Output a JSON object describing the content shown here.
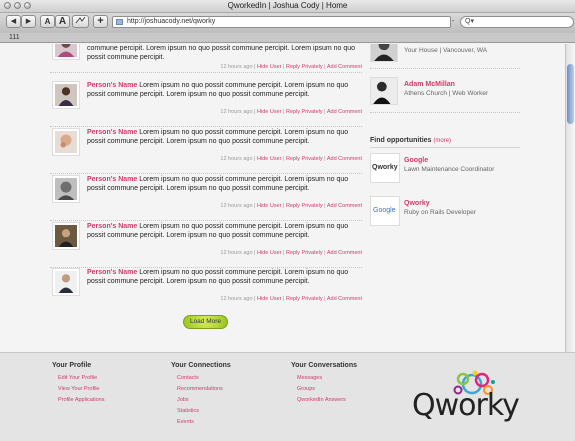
{
  "window": {
    "title": "QworkedIn | Joshua Cody | Home"
  },
  "toolbar": {
    "back_label": "◀",
    "forward_label": "▶",
    "text_smaller_label": "A",
    "text_larger_label": "A",
    "add_bookmark_label": "+",
    "address": "http://joshuacody.net/qworky",
    "search_placeholder": "Q▾"
  },
  "bookmarks_bar": {
    "label": "111"
  },
  "top_post": {
    "text": "commune percipit. Lorem ipsum no quo possit commune percipit. Lorem ipsum no quo possit commune percipit.",
    "time": "12 hours ago",
    "hide": "Hide User",
    "reply": "Reply Privately",
    "comment": "Add Comment"
  },
  "posts": [
    {
      "name": "Person's Name",
      "line1": "Lorem ipsum no quo possit commune percipit. Lorem ipsum no quo",
      "line2": "possit commune percipit. Lorem ipsum no quo possit commune percipit.",
      "time": "12 hours ago",
      "hide": "Hide User",
      "reply": "Reply Privately",
      "comment": "Add Comment"
    },
    {
      "name": "Person's Name",
      "line1": "Lorem ipsum no quo possit commune percipit. Lorem ipsum no quo",
      "line2": "possit commune percipit. Lorem ipsum no quo possit commune percipit.",
      "time": "12 hours ago",
      "hide": "Hide User",
      "reply": "Reply Privately",
      "comment": "Add Comment"
    },
    {
      "name": "Person's Name",
      "line1": "Lorem ipsum no quo possit commune percipit. Lorem ipsum no quo",
      "line2": "possit commune percipit. Lorem ipsum no quo possit commune percipit.",
      "time": "12 hours ago",
      "hide": "Hide User",
      "reply": "Reply Privately",
      "comment": "Add Comment"
    },
    {
      "name": "Person's Name",
      "line1": "Lorem ipsum no quo possit commune percipit. Lorem ipsum no quo",
      "line2": "possit commune percipit. Lorem ipsum no quo possit commune percipit.",
      "time": "12 hours ago",
      "hide": "Hide User",
      "reply": "Reply Privately",
      "comment": "Add Comment"
    },
    {
      "name": "Person's Name",
      "line1": "Lorem ipsum no quo possit commune percipit. Lorem ipsum no quo",
      "line2": "possit commune percipit. Lorem ipsum no quo possit commune percipit.",
      "time": "12 hours ago",
      "hide": "Hide User",
      "reply": "Reply Privately",
      "comment": "Add Comment"
    }
  ],
  "load_more": "Load More",
  "sidebar": {
    "people": [
      {
        "name": "",
        "sub": "Your House | Vancouver, WA"
      },
      {
        "name": "Adam McMillan",
        "sub": "Athens Church | Web Worker"
      }
    ],
    "opportunities_title": "Find opportunities",
    "opportunities_more": "(more)",
    "opportunities": [
      {
        "logo": "Qworky",
        "name": "Google",
        "sub": "Lawn Maintenance Coordinator"
      },
      {
        "logo": "Google",
        "name": "Qworky",
        "sub": "Ruby on Rails Developer"
      }
    ]
  },
  "footer": {
    "profile": {
      "title": "Your Profile",
      "links": [
        "Edit Your Profile",
        "View Your Profile",
        "Profile Applications"
      ]
    },
    "connections": {
      "title": "Your Connections",
      "links": [
        "Contacts",
        "Recommendations",
        "Jobs",
        "Statistics",
        "Events"
      ]
    },
    "conversations": {
      "title": "Your Conversations",
      "links": [
        "Messages",
        "Groups",
        "QworkedIn Answers"
      ]
    },
    "logo_text": "Qworky"
  },
  "colors": {
    "accent": "#d33a6a",
    "button": "#a8cf2a"
  }
}
